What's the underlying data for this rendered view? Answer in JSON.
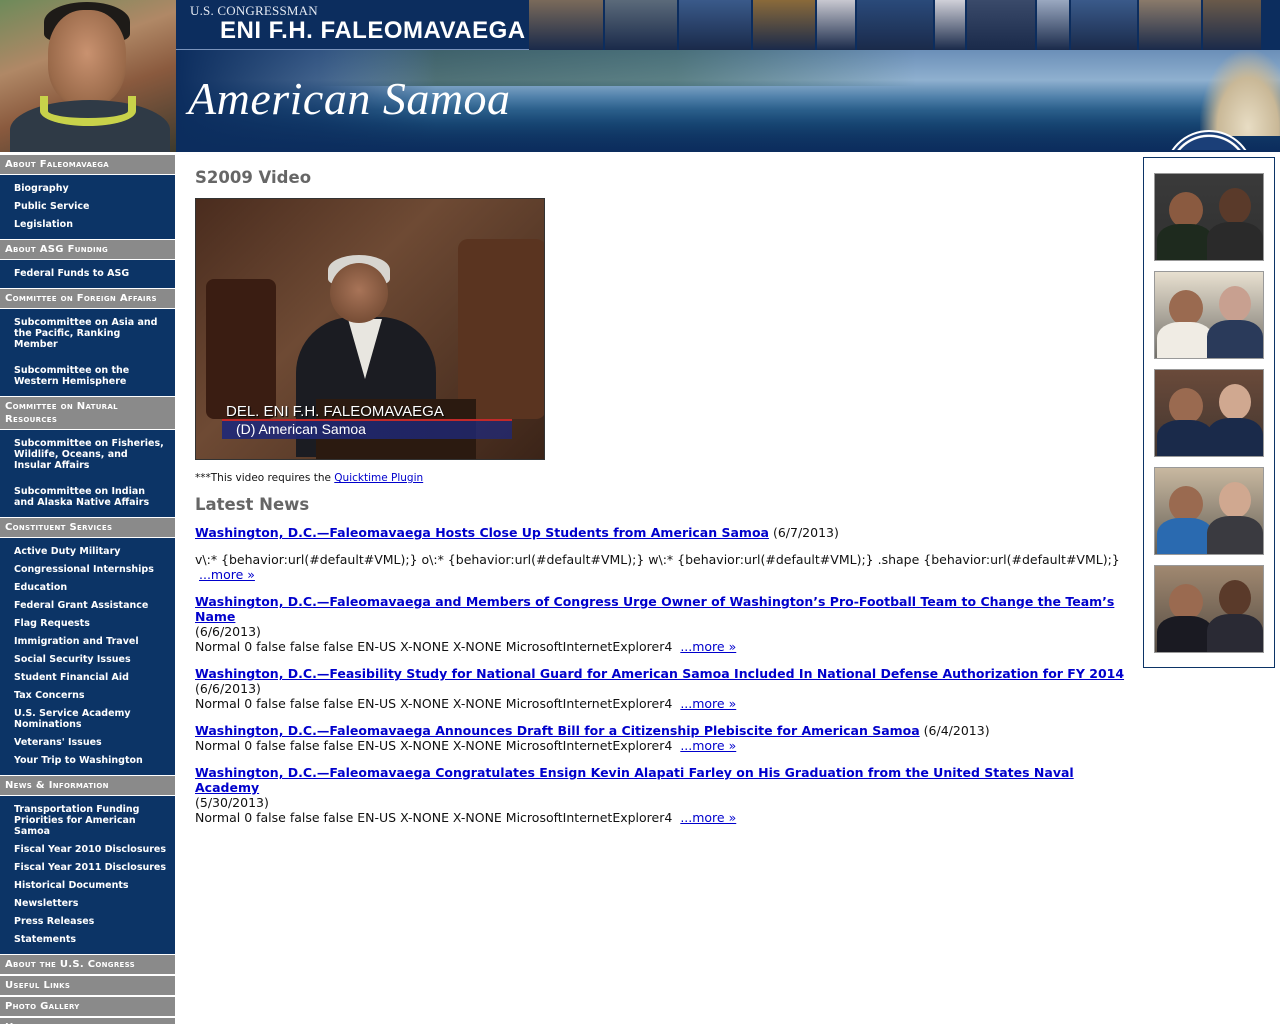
{
  "header": {
    "title_small": "U.S. CONGRESSMAN",
    "title_big": "ENI F.H. FALEOMAVAEGA",
    "banner_title": "American Samoa",
    "photo_strip_colors": [
      "#7a6a5a",
      "#5b6a7a",
      "#3a5a8a",
      "#8a6a3a",
      "#c8c8d0",
      "#2a4a7a",
      "#d0d0d8",
      "#3a4a6a",
      "#9aa8c0",
      "#3a5a8a",
      "#8a7a6a",
      "#6a5a4a"
    ]
  },
  "sidebar": {
    "sections": [
      {
        "heading": "About Faleomavaega",
        "items": [
          "Biography",
          "Public Service",
          "Legislation"
        ]
      },
      {
        "heading": "About ASG Funding",
        "items": [
          "Federal Funds to ASG"
        ]
      },
      {
        "heading": "Committee on Foreign Affairs",
        "items": [
          "Subcommittee on Asia and the Pacific, Ranking Member",
          "Subcommittee on the Western Hemisphere"
        ]
      },
      {
        "heading": "Committee on Natural Resources",
        "items": [
          "Subcommittee on Fisheries, Wildlife, Oceans, and Insular Affairs",
          "Subcommittee on Indian and Alaska Native Affairs"
        ]
      },
      {
        "heading": "Constituent Services",
        "items": [
          "Active Duty Military",
          "Congressional Internships",
          "Education",
          "Federal Grant Assistance",
          "Flag Requests",
          "Immigration and Travel",
          "Social Security Issues",
          "Student Financial Aid",
          "Tax Concerns",
          "U.S. Service Academy Nominations",
          "Veterans' Issues",
          "Your Trip to Washington"
        ]
      },
      {
        "heading": "News & Information",
        "items": [
          "Transportation Funding Priorities for American Samoa",
          "Fiscal Year 2010 Disclosures",
          "Fiscal Year 2011 Disclosures",
          "Historical Documents",
          "Newsletters",
          "Press Releases",
          "Statements"
        ]
      },
      {
        "heading": "About the U.S. Congress",
        "items": []
      },
      {
        "heading": "Useful Links",
        "items": []
      },
      {
        "heading": "Photo Gallery",
        "items": []
      },
      {
        "heading": "Home",
        "items": []
      }
    ]
  },
  "main": {
    "video_title": "S2009 Video",
    "video_caption_line1": "DEL. ENI F.H. FALEOMAVAEGA",
    "video_caption_line2": "(D) American Samoa",
    "plugin_note_prefix": "***This video requires the ",
    "plugin_link": "Quicktime Plugin",
    "news_title": "Latest News",
    "news": [
      {
        "headline": "Washington, D.C.—Faleomavaega Hosts Close Up Students from American Samoa",
        "date": "(6/7/2013)",
        "summary": "v\\:* {behavior:url(#default#VML);} o\\:* {behavior:url(#default#VML);} w\\:* {behavior:url(#default#VML);} .shape {behavior:url(#default#VML);}",
        "more": "...more »"
      },
      {
        "headline": "Washington, D.C.—Faleomavaega and Members of Congress Urge Owner of Washington’s Pro-Football Team to Change the Team’s Name",
        "date": "(6/6/2013)",
        "summary": "Normal 0 false false false EN-US X-NONE X-NONE MicrosoftInternetExplorer4",
        "more": "...more »"
      },
      {
        "headline": "Washington, D.C.—Feasibility Study for National Guard for American Samoa Included In National Defense Authorization for FY 2014",
        "date": "(6/6/2013)",
        "summary": "Normal 0 false false false EN-US X-NONE X-NONE MicrosoftInternetExplorer4",
        "more": "...more »"
      },
      {
        "headline": "Washington, D.C.—Faleomavaega Announces Draft Bill for a Citizenship Plebiscite for American Samoa",
        "date": "(6/4/2013)",
        "summary": "Normal 0 false false false EN-US X-NONE X-NONE MicrosoftInternetExplorer4",
        "more": "...more »"
      },
      {
        "headline": "Washington, D.C.—Faleomavaega Congratulates Ensign Kevin Alapati Farley on His Graduation from the United States Naval Academy",
        "date": "(5/30/2013)",
        "summary": "Normal 0 false false false EN-US X-NONE X-NONE MicrosoftInternetExplorer4",
        "more": "...more »"
      }
    ]
  },
  "right_photos": [
    {
      "bg": "#3a3a3a",
      "a_face": "#8a5a40",
      "a_body": "#1e2a1e",
      "b_face": "#5a3a2a",
      "b_body": "#2a2a2a"
    },
    {
      "bg": "#e8e0d0",
      "a_face": "#9a6a50",
      "a_body": "#f0ece4",
      "b_face": "#c8a090",
      "b_body": "#2a3a5a"
    },
    {
      "bg": "#6a4a3a",
      "a_face": "#9a6a50",
      "a_body": "#1a2a4a",
      "b_face": "#d0a890",
      "b_body": "#1a2a4a"
    },
    {
      "bg": "#c8b8a0",
      "a_face": "#9a6a50",
      "a_body": "#2a6ab0",
      "b_face": "#d0a890",
      "b_body": "#3a3a40"
    },
    {
      "bg": "#a08870",
      "a_face": "#9a6a50",
      "a_body": "#1a1a22",
      "b_face": "#5a3a2a",
      "b_body": "#2a2a34"
    }
  ]
}
